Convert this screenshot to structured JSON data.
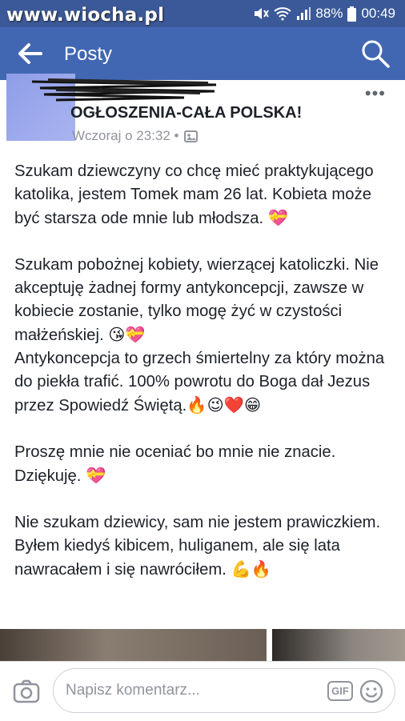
{
  "status": {
    "watermark": "www.wiocha.pl",
    "battery": "88%",
    "time": "00:49",
    "icons": [
      "mute-icon",
      "wifi-icon",
      "signal-icon",
      "battery-icon"
    ]
  },
  "header": {
    "title": "Posty",
    "back_icon": "back-arrow-icon",
    "search_icon": "search-icon"
  },
  "post": {
    "page_name": "OGŁOSZENIA-CAŁA POLSKA!",
    "timestamp": "Wczoraj o 23:32 •",
    "paragraphs": [
      {
        "text": "Szukam dziewczyny co chcę mieć praktykującego katolika, jestem Tomek mam 26 lat. Kobieta może być starsza ode mnie lub młodsza. ",
        "emoji": "💝"
      },
      {
        "text": "Szukam pobożnej kobiety, wierzącej katoliczki. Nie akceptuję żadnej formy antykoncepcji, zawsze w kobiecie zostanie, tylko mogę żyć w czystości małżeńskiej. ",
        "emoji": "😘💝",
        "text2": "Antykoncepcja to grzech śmiertelny za który można do piekła trafić. 100% powrotu do Boga dał Jezus przez Spowiedź Świętą.",
        "emoji2": "🔥😉❤️😁"
      },
      {
        "text": "Proszę mnie nie oceniać bo mnie nie znacie. Dziękuję. ",
        "emoji": "💝"
      },
      {
        "text": "Nie szukam dziewicy, sam nie jestem prawiczkiem.\nByłem kiedyś kibicem, huliganem, ale się lata nawracałem i się nawróciłem. ",
        "emoji": "💪🔥"
      }
    ]
  },
  "comment": {
    "placeholder": "Napisz komentarz...",
    "gif_label": "GIF"
  },
  "colors": {
    "brand_dark": "#3b5998",
    "brand": "#4267b2",
    "muted": "#90949c"
  }
}
